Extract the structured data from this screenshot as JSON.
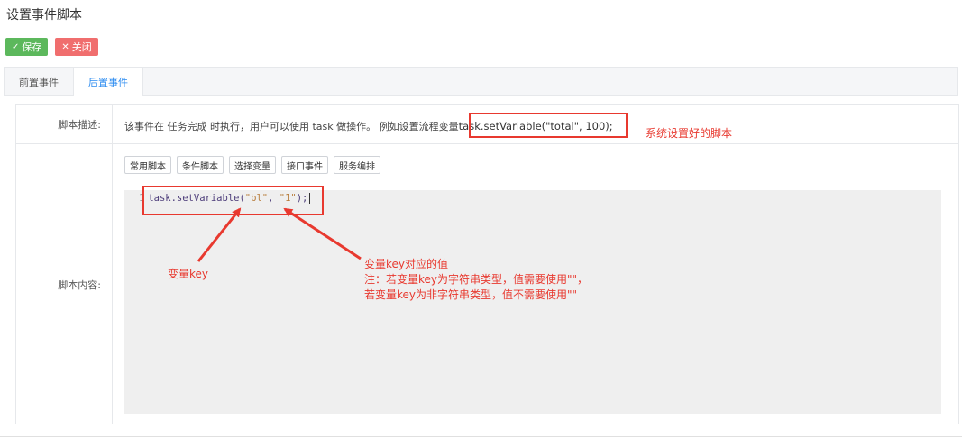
{
  "page": {
    "title": "设置事件脚本"
  },
  "toolbar": {
    "save_label": "保存",
    "close_label": "关闭",
    "save_icon": "check-icon",
    "close_icon": "x-icon"
  },
  "tabs": [
    {
      "label": "前置事件",
      "active": false
    },
    {
      "label": "后置事件",
      "active": true
    }
  ],
  "form": {
    "desc_label": "脚本描述:",
    "desc_text": "该事件在 任务完成 时执行，用户可以使用 task 做操作。 例如设置流程变量",
    "desc_code": "task.setVariable(\"total\", 100);",
    "content_label": "脚本内容:",
    "script_buttons": [
      "常用脚本",
      "条件脚本",
      "选择变量",
      "接口事件",
      "服务编排"
    ]
  },
  "editor": {
    "line_number": "1",
    "code_fn": "task.setVariable(",
    "code_str1": "\"bl\"",
    "code_sep": ", ",
    "code_str2": "\"1\"",
    "code_end": ");"
  },
  "annotations": {
    "system_script": "系统设置好的脚本",
    "var_key": "变量key",
    "value_title": "变量key对应的值",
    "note1": "注：若变量key为字符串类型，值需要使用\"\"，",
    "note2": "若变量key为非字符串类型，值不需要使用\"\""
  },
  "colors": {
    "annotation_red": "#e8392f",
    "save_green": "#5cb85c",
    "close_red": "#f06e6e",
    "tab_active_blue": "#2d8cf0",
    "editor_bg": "#efefef"
  }
}
